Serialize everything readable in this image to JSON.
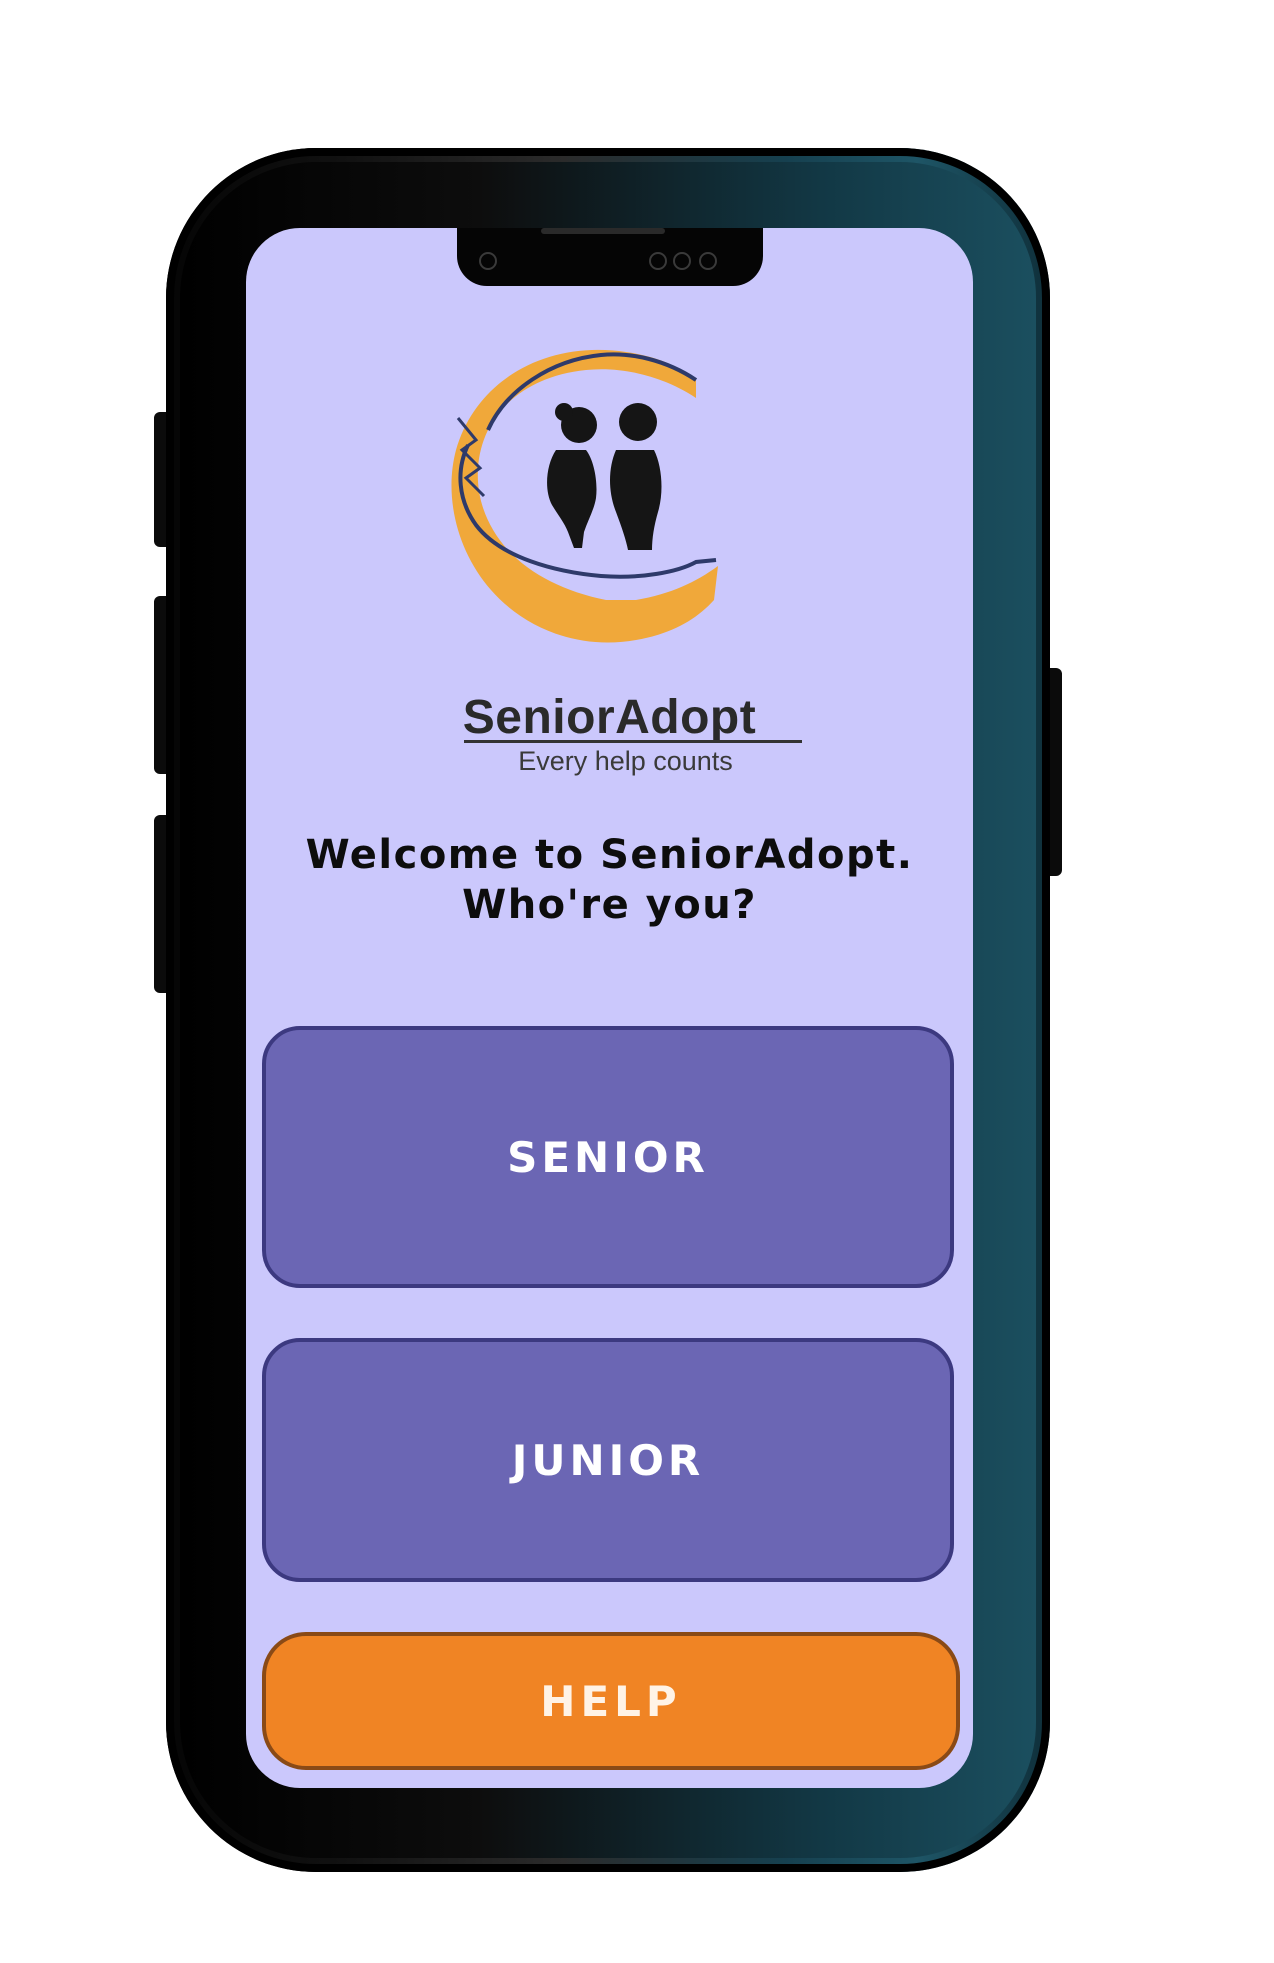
{
  "app": {
    "brand_name": "SeniorAdopt",
    "tagline": "Every help counts"
  },
  "welcome": {
    "line1": "Welcome to SeniorAdopt.",
    "line2": "Who're you?"
  },
  "buttons": {
    "senior": "SENIOR",
    "junior": "JUNIOR",
    "help": "HELP"
  },
  "colors": {
    "screen_bg": "#cbc8fc",
    "role_button": "#6b66b4",
    "help_button": "#f08424",
    "logo_accent": "#f0a83a"
  }
}
